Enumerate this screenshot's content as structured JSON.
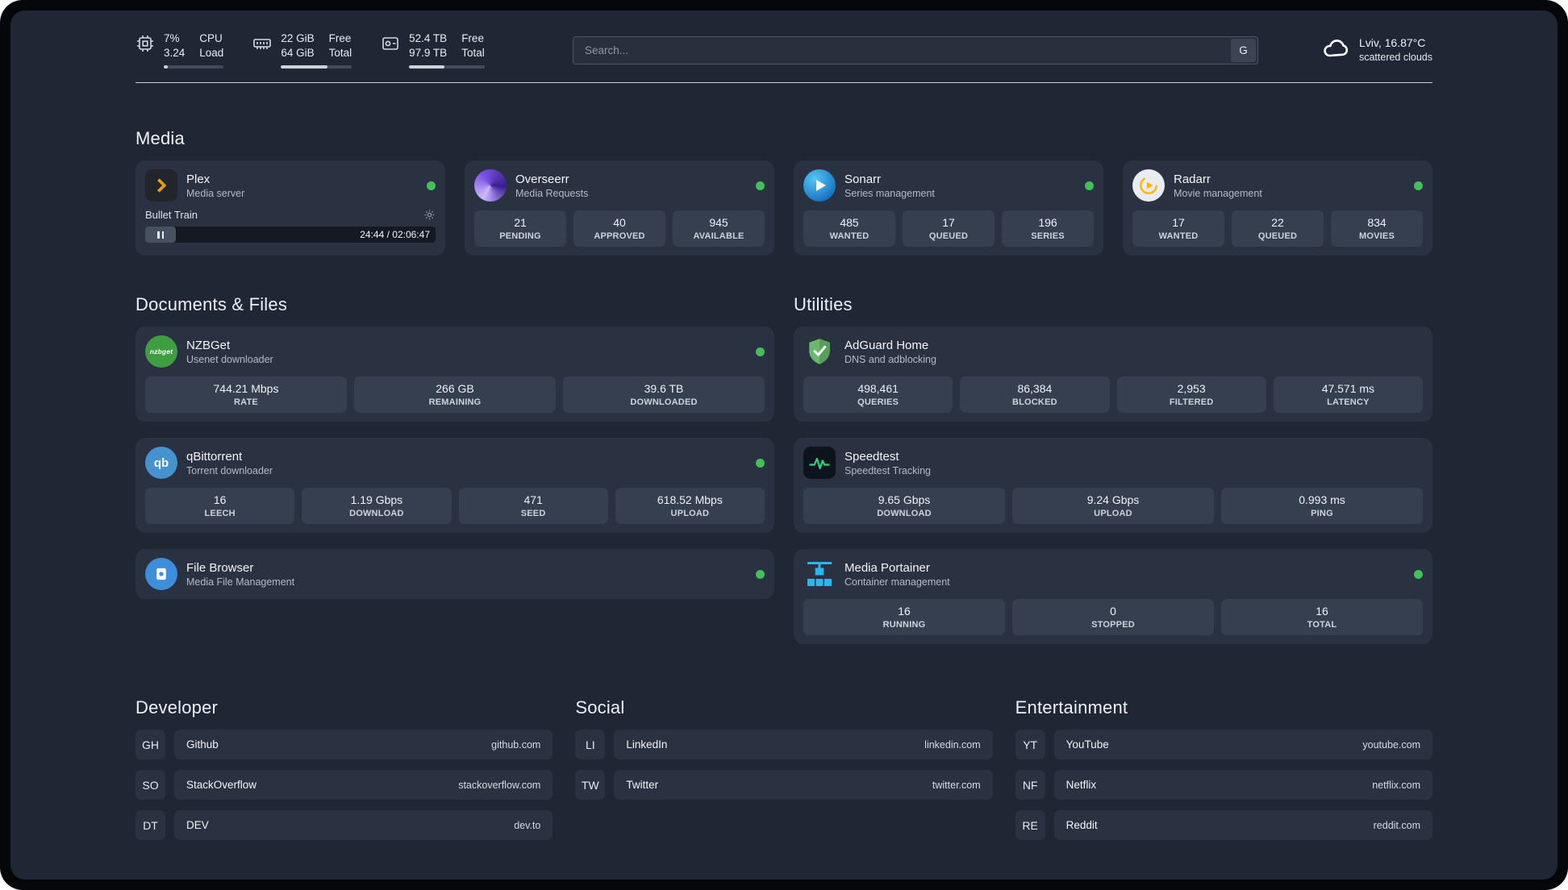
{
  "colors": {
    "background": "#1f2735",
    "card": "#2a3241",
    "status_online": "#41c157",
    "plex_accent": "#e5a00d",
    "adguard_green": "#67b46a",
    "portainer_blue": "#2ab6ee"
  },
  "topbar": {
    "cpu": {
      "value": "7%",
      "sub": "3.24",
      "label_top": "CPU",
      "label_bottom": "Load",
      "percent": 7
    },
    "ram": {
      "value": "22 GiB",
      "sub": "64 GiB",
      "label_top": "Free",
      "label_bottom": "Total",
      "percent": 66
    },
    "disk": {
      "value": "52.4 TB",
      "sub": "97.9 TB",
      "label_top": "Free",
      "label_bottom": "Total",
      "percent": 47
    },
    "search": {
      "placeholder": "Search...",
      "button_label": "G"
    },
    "weather": {
      "location": "Lviv, 16.87°C",
      "condition": "scattered clouds"
    }
  },
  "media": {
    "title": "Media",
    "plex": {
      "name": "Plex",
      "subtitle": "Media server",
      "now_playing": "Bullet Train",
      "time": "24:44 / 02:06:47"
    },
    "overseerr": {
      "name": "Overseerr",
      "subtitle": "Media Requests",
      "stats": [
        {
          "value": "21",
          "label": "PENDING"
        },
        {
          "value": "40",
          "label": "APPROVED"
        },
        {
          "value": "945",
          "label": "AVAILABLE"
        }
      ]
    },
    "sonarr": {
      "name": "Sonarr",
      "subtitle": "Series management",
      "stats": [
        {
          "value": "485",
          "label": "WANTED"
        },
        {
          "value": "17",
          "label": "QUEUED"
        },
        {
          "value": "196",
          "label": "SERIES"
        }
      ]
    },
    "radarr": {
      "name": "Radarr",
      "subtitle": "Movie management",
      "stats": [
        {
          "value": "17",
          "label": "WANTED"
        },
        {
          "value": "22",
          "label": "QUEUED"
        },
        {
          "value": "834",
          "label": "MOVIES"
        }
      ]
    }
  },
  "documents": {
    "title": "Documents & Files",
    "nzbget": {
      "name": "NZBGet",
      "subtitle": "Usenet downloader",
      "icon_text": "nzbget",
      "stats": [
        {
          "value": "744.21 Mbps",
          "label": "RATE"
        },
        {
          "value": "266 GB",
          "label": "REMAINING"
        },
        {
          "value": "39.6 TB",
          "label": "DOWNLOADED"
        }
      ]
    },
    "qbittorrent": {
      "name": "qBittorrent",
      "subtitle": "Torrent downloader",
      "icon_text": "qb",
      "stats": [
        {
          "value": "16",
          "label": "LEECH"
        },
        {
          "value": "1.19 Gbps",
          "label": "DOWNLOAD"
        },
        {
          "value": "471",
          "label": "SEED"
        },
        {
          "value": "618.52 Mbps",
          "label": "UPLOAD"
        }
      ]
    },
    "filebrowser": {
      "name": "File Browser",
      "subtitle": "Media File Management"
    }
  },
  "utilities": {
    "title": "Utilities",
    "adguard": {
      "name": "AdGuard Home",
      "subtitle": "DNS and adblocking",
      "stats": [
        {
          "value": "498,461",
          "label": "QUERIES"
        },
        {
          "value": "86,384",
          "label": "BLOCKED"
        },
        {
          "value": "2,953",
          "label": "FILTERED"
        },
        {
          "value": "47.571 ms",
          "label": "LATENCY"
        }
      ]
    },
    "speedtest": {
      "name": "Speedtest",
      "subtitle": "Speedtest Tracking",
      "stats": [
        {
          "value": "9.65 Gbps",
          "label": "DOWNLOAD"
        },
        {
          "value": "9.24 Gbps",
          "label": "UPLOAD"
        },
        {
          "value": "0.993 ms",
          "label": "PING"
        }
      ]
    },
    "portainer": {
      "name": "Media Portainer",
      "subtitle": "Container management",
      "stats": [
        {
          "value": "16",
          "label": "RUNNING"
        },
        {
          "value": "0",
          "label": "STOPPED"
        },
        {
          "value": "16",
          "label": "TOTAL"
        }
      ]
    }
  },
  "bookmarks": {
    "developer": {
      "title": "Developer",
      "items": [
        {
          "abbr": "GH",
          "name": "Github",
          "url": "github.com"
        },
        {
          "abbr": "SO",
          "name": "StackOverflow",
          "url": "stackoverflow.com"
        },
        {
          "abbr": "DT",
          "name": "DEV",
          "url": "dev.to"
        }
      ]
    },
    "social": {
      "title": "Social",
      "items": [
        {
          "abbr": "LI",
          "name": "LinkedIn",
          "url": "linkedin.com"
        },
        {
          "abbr": "TW",
          "name": "Twitter",
          "url": "twitter.com"
        }
      ]
    },
    "entertainment": {
      "title": "Entertainment",
      "items": [
        {
          "abbr": "YT",
          "name": "YouTube",
          "url": "youtube.com"
        },
        {
          "abbr": "NF",
          "name": "Netflix",
          "url": "netflix.com"
        },
        {
          "abbr": "RE",
          "name": "Reddit",
          "url": "reddit.com"
        }
      ]
    }
  }
}
